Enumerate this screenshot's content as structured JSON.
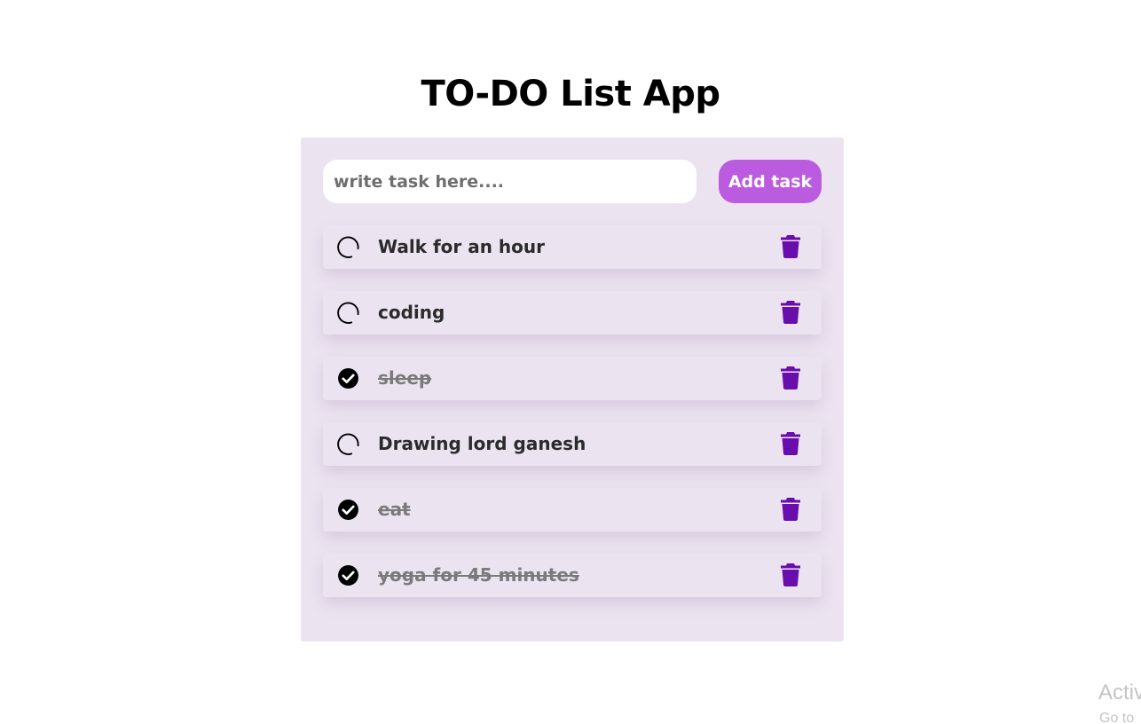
{
  "app": {
    "title": "TO-DO List App"
  },
  "input": {
    "placeholder": "write task here....",
    "value": ""
  },
  "add_button": {
    "label": "Add task"
  },
  "colors": {
    "card_background": "#ece3f1",
    "accent_button": "#bb5ce0",
    "delete_icon": "#6a0dad",
    "done_text": "#7a7a7a"
  },
  "tasks": [
    {
      "label": "Walk for an hour",
      "done": false,
      "check_icon": "circle-icon",
      "delete_icon": "trash-icon"
    },
    {
      "label": "coding",
      "done": false,
      "check_icon": "circle-icon",
      "delete_icon": "trash-icon"
    },
    {
      "label": "sleep",
      "done": true,
      "check_icon": "check-circle-icon",
      "delete_icon": "trash-icon"
    },
    {
      "label": "Drawing lord ganesh",
      "done": false,
      "check_icon": "circle-icon",
      "delete_icon": "trash-icon"
    },
    {
      "label": "eat",
      "done": true,
      "check_icon": "check-circle-icon",
      "delete_icon": "trash-icon"
    },
    {
      "label": "yoga for 45 minutes",
      "done": true,
      "check_icon": "check-circle-icon",
      "delete_icon": "trash-icon"
    }
  ],
  "os_overlay": {
    "line1": "Activ",
    "line2": "Go to"
  }
}
